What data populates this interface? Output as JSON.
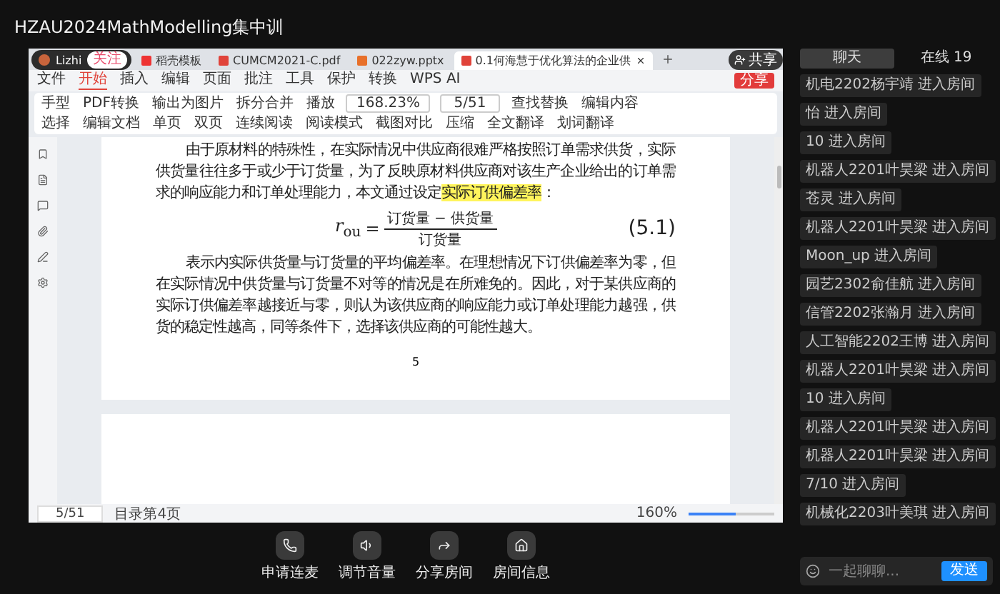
{
  "window": {
    "title": "HZAU2024MathModelling集中训"
  },
  "shared_screen": {
    "streamer": {
      "name": "Lizhi",
      "follow": "关注"
    },
    "share_overlay": "共享",
    "tabs": [
      {
        "label": "稻壳模板",
        "kind": "wps",
        "selected": false
      },
      {
        "label": "CUMCM2021-C.pdf",
        "kind": "pdf",
        "selected": false
      },
      {
        "label": "022zyw.pptx",
        "kind": "ppt",
        "selected": false
      },
      {
        "label": "0.1何海慧于优化算法的企业供",
        "kind": "pdf",
        "selected": true
      }
    ],
    "file_menu": "文件",
    "menu": [
      {
        "label": "开始",
        "selected": true
      },
      {
        "label": "插入",
        "selected": false
      },
      {
        "label": "编辑",
        "selected": false
      },
      {
        "label": "页面",
        "selected": false
      },
      {
        "label": "批注",
        "selected": false
      },
      {
        "label": "工具",
        "selected": false
      },
      {
        "label": "保护",
        "selected": false
      },
      {
        "label": "转换",
        "selected": false
      },
      {
        "label": "WPS AI",
        "selected": false
      }
    ],
    "share_button": "分享",
    "toolbar_rows": [
      [
        {
          "kind": "button",
          "label": "手型"
        },
        {
          "kind": "button",
          "label": "PDF转换"
        },
        {
          "kind": "button",
          "label": "输出为图片"
        },
        {
          "kind": "button",
          "label": "拆分合并"
        },
        {
          "kind": "button",
          "label": "播放"
        },
        {
          "kind": "field",
          "label": "168.23%"
        },
        {
          "kind": "field",
          "label": "5/51"
        },
        {
          "kind": "button",
          "label": "查找替换"
        },
        {
          "kind": "button",
          "label": "编辑内容"
        }
      ],
      [
        {
          "kind": "button",
          "label": "选择"
        },
        {
          "kind": "button",
          "label": "编辑文档"
        },
        {
          "kind": "button",
          "label": "单页"
        },
        {
          "kind": "button",
          "label": "双页"
        },
        {
          "kind": "button",
          "label": "连续阅读"
        },
        {
          "kind": "button",
          "label": "阅读模式"
        },
        {
          "kind": "button",
          "label": "截图对比"
        },
        {
          "kind": "button",
          "label": "压缩"
        },
        {
          "kind": "button",
          "label": "全文翻译"
        },
        {
          "kind": "button",
          "label": "划词翻译"
        }
      ]
    ],
    "document": {
      "paragraph_1": {
        "before": "由于原材料的特殊性，在实际情况中供应商很难严格按照订单需求供货，实际供货量往往多于或少于订货量，为了反映原材料供应商对该生产企业给出的订单需求的响应能力和订单处理能力，本文通过设定",
        "highlight": "实际订供偏差率",
        "after": "："
      },
      "formula": {
        "lhs": "*r*$_{ou}$",
        "equals": "=",
        "numerator": "订货量 − 供货量",
        "denominator": "订货量",
        "tag": "(5.1)"
      },
      "paragraph_2": "表示内实际供货量与订货量的平均偏差率。在理想情况下订供偏差率为零，但在实际情况中供货量与订货量不对等的情况是在所难免的。因此，对于某供应商的实际订供偏差率越接近与零，则认为该供应商的响应能力或订单处理能力越强，供货的稳定性越高，同等条件下，选择该供应商的可能性越大。",
      "page_number": "5"
    },
    "status_bar": {
      "page": "5/51",
      "section": "目录第4页",
      "zoom": "160%",
      "level": 0.55
    }
  },
  "controls": [
    {
      "kind": "phone",
      "label": "申请连麦"
    },
    {
      "kind": "volume",
      "label": "调节音量"
    },
    {
      "kind": "share",
      "label": "分享房间"
    },
    {
      "kind": "info",
      "label": "房间信息"
    }
  ],
  "chat": {
    "tabs": [
      {
        "label": "聊天",
        "selected": true
      },
      {
        "label": "在线 19",
        "selected": false
      }
    ],
    "messages": [
      "机电2202杨宇靖 进入房间",
      "怡 进入房间",
      "10 进入房间",
      "机器人2201叶昊梁 进入房间",
      "苍灵 进入房间",
      "机器人2201叶昊梁 进入房间",
      "Moon_up 进入房间",
      "园艺2302俞佳航 进入房间",
      "信管2202张瀚月 进入房间",
      "人工智能2202王博 进入房间",
      "机器人2201叶昊梁 进入房间",
      "10 进入房间",
      "机器人2201叶昊梁 进入房间",
      "机器人2201叶昊梁 进入房间",
      "7/10 进入房间",
      "机械化2203叶美琪 进入房间"
    ],
    "input": {
      "placeholder": "一起聊聊..."
    },
    "send": "发送"
  }
}
